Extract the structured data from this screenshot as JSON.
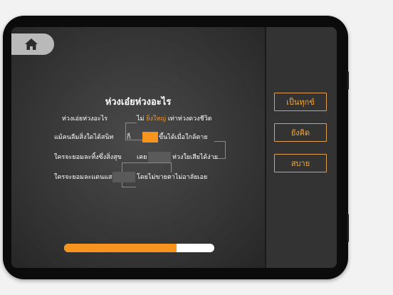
{
  "poem": {
    "title": "ห่วงเอ๋ยห่วงอะไร",
    "rows": [
      {
        "left": "ห่วงเอ่ยห่วงอะไร",
        "right_pre": "ไม่ ",
        "right_hl": "ยิ่งใหญ่",
        "right_post": " เท่าห่วงดวงชีวิต"
      },
      {
        "left": "แม้คนลืมสิ่งใดได้สนิท",
        "right_pre": "ก็",
        "right_post": "ขึ้นได้เมื่อใกล้ตาย"
      },
      {
        "left": "ใครจะยอมละทิ้งซึ่งสิ่งสุข",
        "right_pre": "เคย",
        "right_post": "ห่วงใยเสียได้ง่าย"
      },
      {
        "left": "ใครจะยอมละแดนแสน",
        "right_post": "โดยไม่ขายตาไม่อาลัยเอย"
      }
    ]
  },
  "answers": [
    "เป็นทุกข์",
    "ยังคิด",
    "สบาย"
  ],
  "progress": {
    "percent": 75
  },
  "colors": {
    "accent": "#f7941d",
    "blank_empty": "#5a5a5a"
  },
  "icons": {
    "home": "home-icon"
  }
}
